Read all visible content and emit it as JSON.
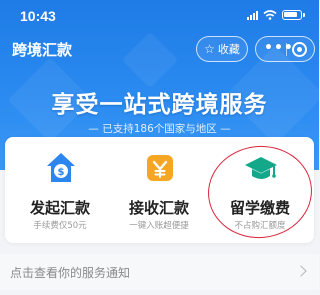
{
  "status_bar": {
    "time": "10:43"
  },
  "nav": {
    "title": "跨境汇款",
    "favorite_label": "收藏",
    "more_label": "•••"
  },
  "hero": {
    "slogan": "享受一站式跨境服务",
    "support_text": "— 已支持186个国家与地区 —"
  },
  "services": [
    {
      "title": "发起汇款",
      "subtitle": "手续费仅50元",
      "icon": "dollar-shield-icon"
    },
    {
      "title": "接收汇款",
      "subtitle": "一键入账超便捷",
      "icon": "yen-download-icon"
    },
    {
      "title": "留学缴费",
      "subtitle": "不占购汇额度",
      "icon": "graduation-cap-icon"
    }
  ],
  "notice": {
    "text": "点击查看你的服务通知"
  },
  "colors": {
    "brand_blue": "#1f7be6",
    "highlight_red": "#d9263b",
    "icon_blue": "#2b86f0",
    "icon_orange": "#f5a623",
    "icon_green": "#14a88a"
  }
}
